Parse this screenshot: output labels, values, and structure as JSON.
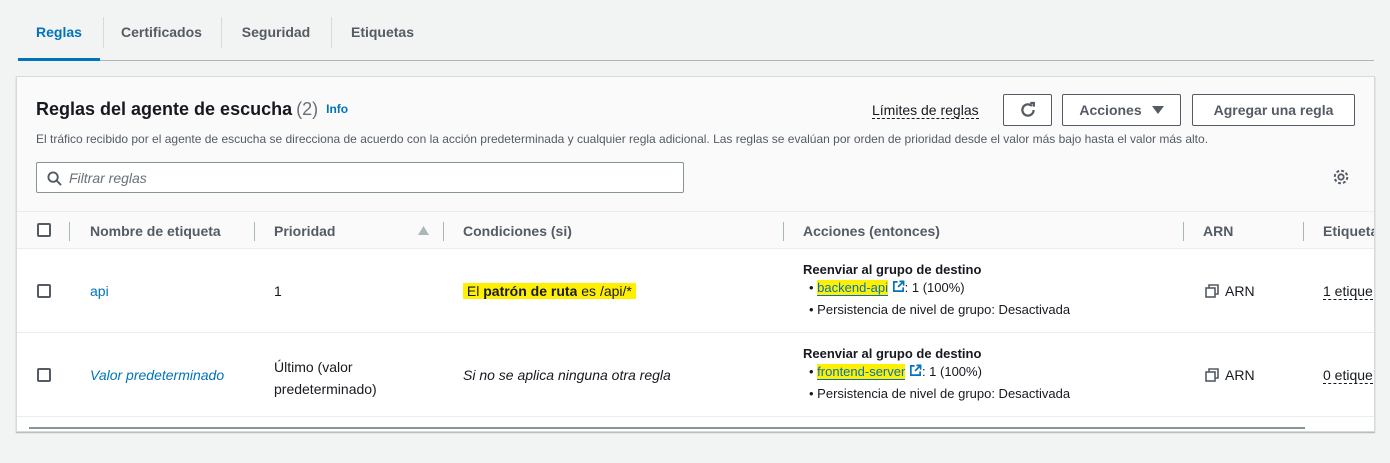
{
  "tabs": [
    {
      "label": "Reglas",
      "active": true
    },
    {
      "label": "Certificados",
      "active": false
    },
    {
      "label": "Seguridad",
      "active": false
    },
    {
      "label": "Etiquetas",
      "active": false
    }
  ],
  "panel": {
    "title": "Reglas del agente de escucha",
    "count": "(2)",
    "info": "Info",
    "limits_link": "Límites de reglas",
    "actions_button": "Acciones",
    "add_rule_button": "Agregar una regla",
    "description": "El tráfico recibido por el agente de escucha se direcciona de acuerdo con la acción predeterminada y cualquier regla adicional. Las reglas se evalúan por orden de prioridad desde el valor más bajo hasta el valor más alto.",
    "search_placeholder": "Filtrar reglas"
  },
  "table": {
    "headers": {
      "name": "Nombre de etiqueta",
      "priority": "Prioridad",
      "conditions": "Condiciones (si)",
      "actions": "Acciones (entonces)",
      "arn": "ARN",
      "tags": "Etiqueta"
    },
    "rows": [
      {
        "name": "api",
        "priority": "1",
        "condition_prefix": "El",
        "condition_bold": "patrón de ruta",
        "condition_mid": "es",
        "condition_value": "/api/*",
        "action_title": "Reenviar al grupo de destino",
        "target_name": "backend-api",
        "target_weight": ": 1 (100%)",
        "persistence": "Persistencia de nivel de grupo: Desactivada",
        "arn": "ARN",
        "tags": "1 etique"
      },
      {
        "name": "Valor predeterminado",
        "priority_line1": "Último (valor",
        "priority_line2": "predeterminado)",
        "condition": "Si no se aplica ninguna otra regla",
        "action_title": "Reenviar al grupo de destino",
        "target_name": "frontend-server",
        "target_weight": ": 1 (100%)",
        "persistence": "Persistencia de nivel de grupo: Desactivada",
        "arn": "ARN",
        "tags": "0 etique"
      }
    ]
  },
  "colors": {
    "accent": "#0073bb",
    "highlight": "#ffef00"
  },
  "icons": [
    "refresh-icon",
    "caret-down-icon",
    "search-icon",
    "settings-icon",
    "sort-ascending-icon",
    "external-link-icon",
    "copy-icon"
  ]
}
